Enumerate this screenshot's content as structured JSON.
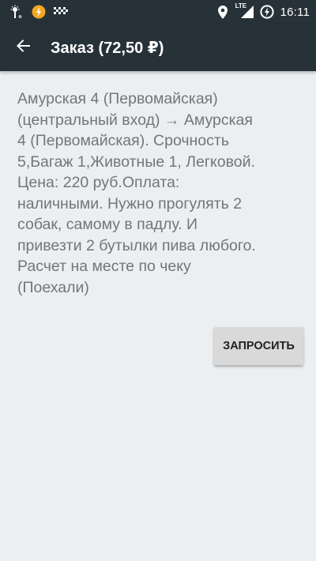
{
  "status_bar": {
    "time": "16:11",
    "network_label": "LTE",
    "left_icons": [
      "weather-icon",
      "bolt-notification-icon",
      "taxi-checker-icon"
    ],
    "right_icons": [
      "location-icon",
      "signal-icon",
      "data-saver-icon"
    ]
  },
  "app_bar": {
    "title": "Заказ (72,50 ₽)",
    "back_icon": "arrow-back-icon"
  },
  "order": {
    "description": "Амурская 4 (Первомайская)\n(центральный вход) → Амурская\n4 (Первомайская). Срочность\n5,Багаж 1,Животные 1, Легковой.\nЦена: 220 руб.Оплата:\nналичными. Нужно прогулять 2\nсобак, самому в падлу. И\nпривезти 2 бутылки пива любого.\nРасчет на месте по чеку\n(Поехали)"
  },
  "actions": {
    "request_label": "ЗАПРОСИТЬ"
  },
  "colors": {
    "app_bar": "#263238",
    "background": "#eceff1",
    "button": "#d9d9d9",
    "text": "#757575"
  }
}
